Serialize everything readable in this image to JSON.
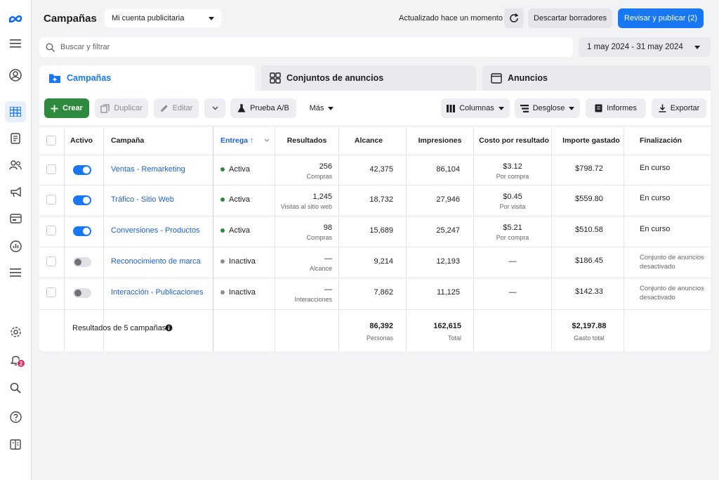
{
  "header": {
    "title": "Campañas",
    "account": "Mi cuenta publicitaria",
    "updated": "Actualizado hace un momento",
    "discard": "Descartar borradores",
    "publish": "Revisar y publicar (2)"
  },
  "search": {
    "placeholder": "Buscar y filtrar"
  },
  "daterange": "1 may 2024 - 31 may 2024",
  "tabs": [
    "Campañas",
    "Conjuntos de anuncios",
    "Anuncios"
  ],
  "toolbar": {
    "create": "Crear",
    "duplicate": "Duplicar",
    "edit": "Editar",
    "ab_test": "Prueba A/B",
    "more": "Más",
    "columns": "Columnas",
    "breakdown": "Desglose",
    "reports": "Informes",
    "export": "Exportar"
  },
  "columns": [
    "Activo",
    "Campaña",
    "Entrega ↑",
    "Resultados",
    "Alcance",
    "Impresiones",
    "Costo por resultado",
    "Importe gastado",
    "Finalización"
  ],
  "rows": [
    {
      "active": true,
      "name": "Ventas - Remarketing",
      "delivery": "Activa",
      "results": "256",
      "results_sub": "Compras",
      "reach": "42,375",
      "impressions": "86,104",
      "cpr": "$3.12",
      "cpr_sub": "Por compra",
      "spent": "$798.72",
      "end": "En curso",
      "end2": ""
    },
    {
      "active": true,
      "name": "Tráfico - Sitio Web",
      "delivery": "Activa",
      "results": "1,245",
      "results_sub": "Visitas al sitio web",
      "reach": "18,732",
      "impressions": "27,946",
      "cpr": "$0.45",
      "cpr_sub": "Por visita",
      "spent": "$559.80",
      "end": "En curso",
      "end2": ""
    },
    {
      "active": true,
      "name": "Conversiones - Productos",
      "delivery": "Activa",
      "results": "98",
      "results_sub": "Compras",
      "reach": "15,689",
      "impressions": "25,247",
      "cpr": "$5.21",
      "cpr_sub": "Por compra",
      "spent": "$510.58",
      "end": "En curso",
      "end2": ""
    },
    {
      "active": false,
      "name": "Reconocimiento de marca",
      "delivery": "Inactiva",
      "results": "—",
      "results_sub": "Alcance",
      "reach": "9,214",
      "impressions": "12,193",
      "cpr": "—",
      "cpr_sub": "",
      "spent": "$186.45",
      "end": "Conjunto de anuncios",
      "end2": "desactivado"
    },
    {
      "active": false,
      "name": "Interacción - Publicaciones",
      "delivery": "Inactiva",
      "results": "—",
      "results_sub": "Interacciones",
      "reach": "7,862",
      "impressions": "11,125",
      "cpr": "—",
      "cpr_sub": "",
      "spent": "$142.33",
      "end": "Conjunto de anuncios",
      "end2": "desactivado"
    }
  ],
  "totals": {
    "label": "Resultados de 5 campañas",
    "reach": "86,392",
    "reach_sub": "Personas",
    "impressions": "162,615",
    "impressions_sub": "Total",
    "spent": "$2,197.88",
    "spent_sub": "Gasto total"
  },
  "colors": {
    "accent": "#1877f2",
    "create": "#2e8b3d",
    "active_dot": "#2e8b3d",
    "inactive_dot": "#8a8d91"
  },
  "rail_icons": [
    "meta-logo-icon",
    "menu-icon",
    "account-icon",
    "campaigns-grid-icon",
    "document-icon",
    "audience-icon",
    "megaphone-icon",
    "billing-icon",
    "analytics-icon",
    "list-icon",
    "settings-icon",
    "notifications-icon",
    "search-icon",
    "help-icon",
    "book-icon"
  ],
  "notification_count": "2"
}
